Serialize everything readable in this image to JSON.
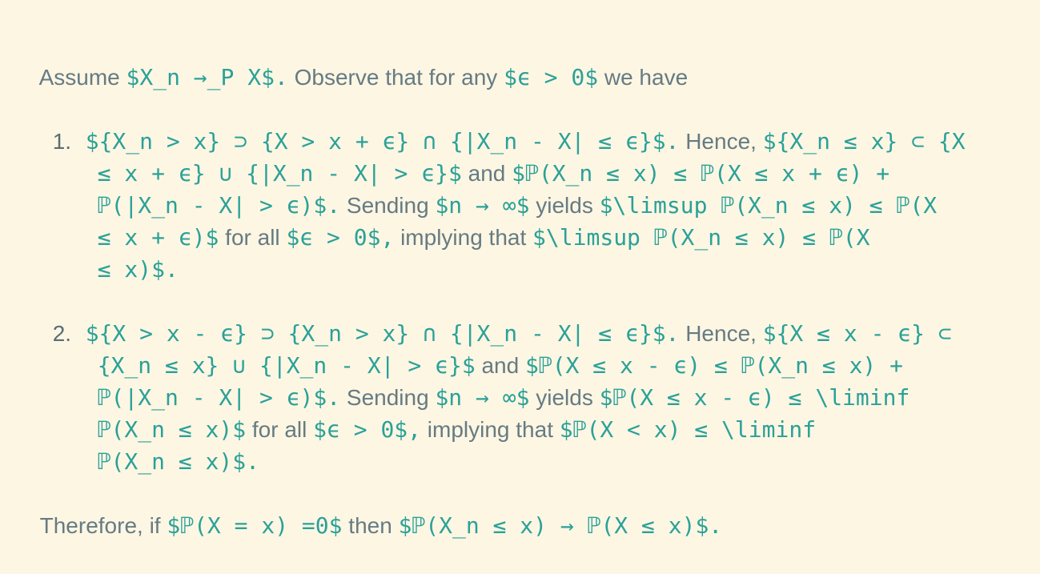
{
  "intro": {
    "t1": "Assume ",
    "m1": "$X_n →_P X$.",
    "t2": " Observe that for any ",
    "m2": "$ϵ > 0$",
    "t3": " we have"
  },
  "item1": {
    "number": "1.",
    "l1": {
      "m1": "${X_n > x} ⊃ {X > x + ϵ} ∩ {|X_n - X| ≤ ϵ}$.",
      "t1": " Hence, ",
      "m2": "${X_n ≤ x} ⊂ {X"
    },
    "l2": {
      "m1": "≤ x + ϵ} ∪ {|X_n - X| > ϵ}$",
      "t1": " and ",
      "m2": "$ℙ(X_n ≤ x) ≤ ℙ(X ≤ x + ϵ) +"
    },
    "l3": {
      "m1": "ℙ(|X_n - X| > ϵ)$.",
      "t1": " Sending ",
      "m2": "$n → ∞$",
      "t2": " yields ",
      "m3": "$\\limsup ℙ(X_n ≤ x) ≤ ℙ(X"
    },
    "l4": {
      "m1": "≤ x + ϵ)$",
      "t1": " for all ",
      "m2": "$ϵ > 0$,",
      "t2": " implying that ",
      "m3": "$\\limsup ℙ(X_n ≤ x) ≤ ℙ(X"
    },
    "l5": {
      "m1": "≤ x)$."
    }
  },
  "item2": {
    "number": "2.",
    "l1": {
      "m1": "${X > x - ϵ} ⊃ {X_n > x} ∩ {|X_n - X| ≤ ϵ}$.",
      "t1": " Hence, ",
      "m2": "${X ≤ x - ϵ} ⊂"
    },
    "l2": {
      "m1": "{X_n ≤ x} ∪ {|X_n - X| > ϵ}$",
      "t1": " and ",
      "m2": "$ℙ(X ≤ x - ϵ) ≤ ℙ(X_n ≤ x) +"
    },
    "l3": {
      "m1": "ℙ(|X_n - X| > ϵ)$.",
      "t1": " Sending ",
      "m2": "$n → ∞$",
      "t2": " yields ",
      "m3": "$ℙ(X ≤ x - ϵ) ≤ \\liminf"
    },
    "l4": {
      "m1": "ℙ(X_n ≤ x)$",
      "t1": " for all ",
      "m2": "$ϵ > 0$,",
      "t2": " implying that ",
      "m3": "$ℙ(X < x) ≤ \\liminf"
    },
    "l5": {
      "m1": "ℙ(X_n ≤ x)$."
    }
  },
  "conclusion": {
    "t1": "Therefore, if ",
    "m1": "$ℙ(X = x) =0$",
    "t2": " then ",
    "m2": "$ℙ(X_n ≤ x) → ℙ(X ≤ x)$."
  }
}
